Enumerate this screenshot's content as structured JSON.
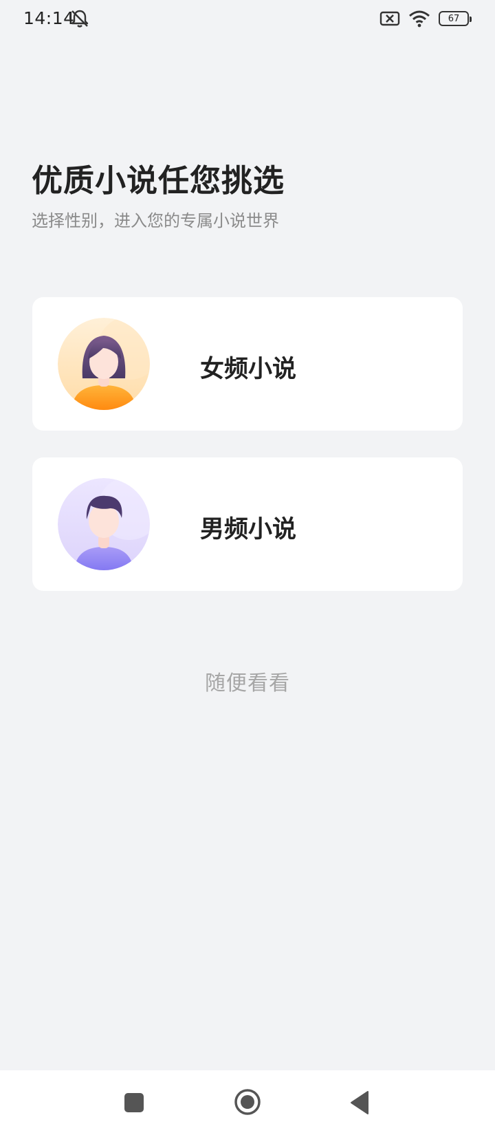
{
  "status_bar": {
    "time": "14:14",
    "battery_level": "67",
    "icons": [
      "mute-icon",
      "sim-error-icon",
      "wifi-icon",
      "battery-icon"
    ]
  },
  "header": {
    "title": "优质小说任您挑选",
    "subtitle": "选择性别，进入您的专属小说世界"
  },
  "options": [
    {
      "label": "女频小说",
      "avatar_icon": "female-avatar-icon",
      "accent": "#ffa020"
    },
    {
      "label": "男频小说",
      "avatar_icon": "male-avatar-icon",
      "accent": "#8f86f5"
    }
  ],
  "browse_label": "随便看看",
  "nav_bar": {
    "icons": [
      "recents-icon",
      "home-icon",
      "back-icon"
    ]
  },
  "colors": {
    "background": "#f2f3f5",
    "card": "#ffffff",
    "muted_text": "#a6a6a6"
  }
}
